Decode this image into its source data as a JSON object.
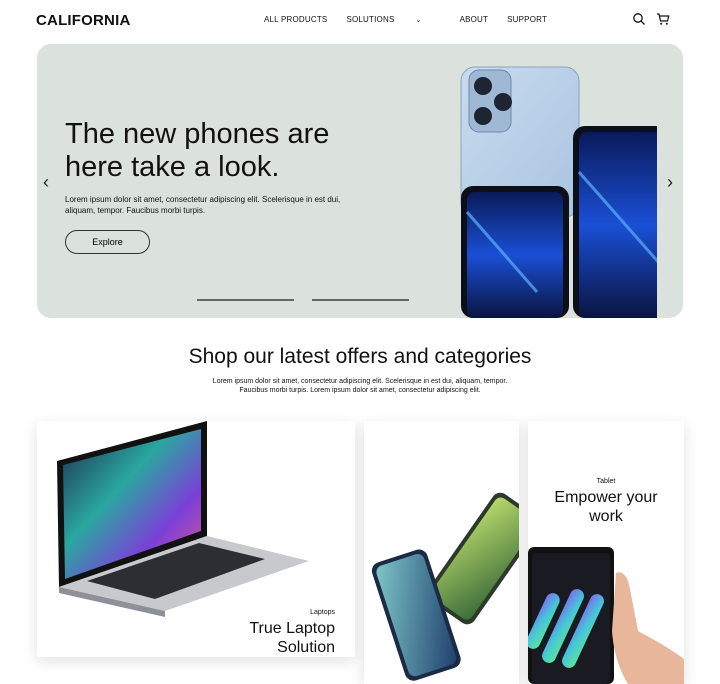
{
  "brand": "CALIFORNIA",
  "nav": {
    "links": [
      "ALL PRODUCTS",
      "SOLUTIONS",
      "ABOUT",
      "SUPPORT"
    ]
  },
  "icons": [
    "search-icon",
    "cart-icon",
    "chevron-down-icon",
    "arrow-left-icon",
    "arrow-right-icon"
  ],
  "hero": {
    "title": "The new phones are here take a look.",
    "text": "Lorem ipsum dolor sit amet, consectetur adipiscing elit. Scelerisque in est dui, aliquam, tempor. Faucibus morbi turpis.",
    "button": "Explore",
    "background_color": "#dbe2de"
  },
  "section": {
    "title": "Shop our latest offers and categories",
    "text": "Lorem ipsum dolor sit amet, consectetur adipiscing elit. Scelerisque in est dui, aliquam, tempor. Faucibus morbi turpis. Lorem ipsum dolor sit amet, consectetur adipiscing elit."
  },
  "cards": {
    "laptop": {
      "category": "Laptops",
      "title": "True Laptop Solution"
    },
    "tablet": {
      "category": "Tablet",
      "title": "Empower your work"
    }
  }
}
